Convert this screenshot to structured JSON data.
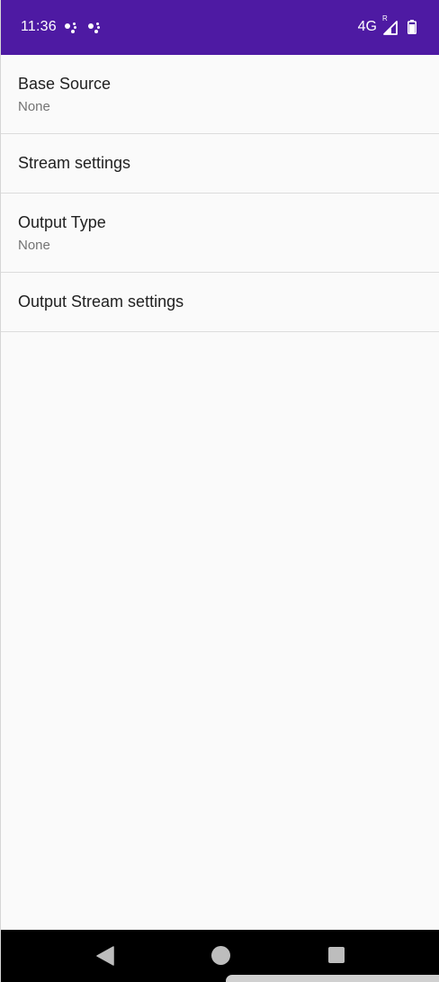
{
  "status_bar": {
    "time": "11:36",
    "network_type": "4G",
    "roaming_indicator": "R",
    "background_color": "#4e1aa3",
    "icons": [
      "assistant-notification-icon",
      "assistant-notification-icon",
      "signal-icon",
      "battery-icon"
    ]
  },
  "preferences": [
    {
      "title": "Base Source",
      "summary": "None"
    },
    {
      "title": "Stream settings"
    },
    {
      "title": "Output Type",
      "summary": "None"
    },
    {
      "title": "Output Stream settings"
    }
  ],
  "nav_bar": {
    "buttons": [
      "back-icon",
      "home-icon",
      "recents-icon"
    ]
  }
}
